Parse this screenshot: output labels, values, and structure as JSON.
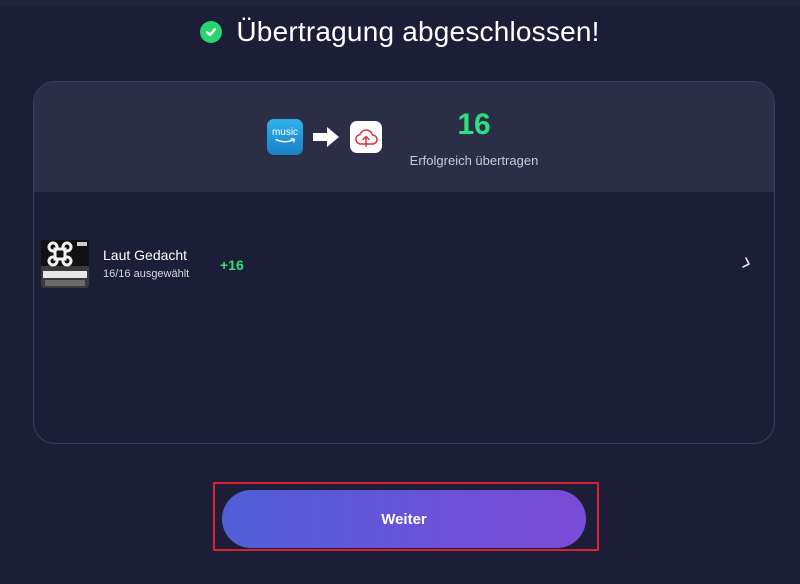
{
  "header": {
    "title": "Übertragung abgeschlossen!",
    "status_icon": "check-circle-icon",
    "status_color": "#27d46f"
  },
  "summary": {
    "source_service": {
      "name": "Amazon Music",
      "icon_text": "music"
    },
    "target_service": {
      "name": "Cloud upload"
    },
    "count": "16",
    "count_label": "Erfolgreich übertragen"
  },
  "playlists": [
    {
      "name": "Laut Gedacht",
      "subtitle": "16/16 ausgewählt",
      "added": "+16"
    }
  ],
  "footer": {
    "button_label": "Weiter"
  },
  "colors": {
    "accent_green": "#2ee07a",
    "background": "#1b1e36",
    "panel": "#2a2e47",
    "button_start": "#4f5fd8",
    "button_end": "#7a4bd6"
  }
}
